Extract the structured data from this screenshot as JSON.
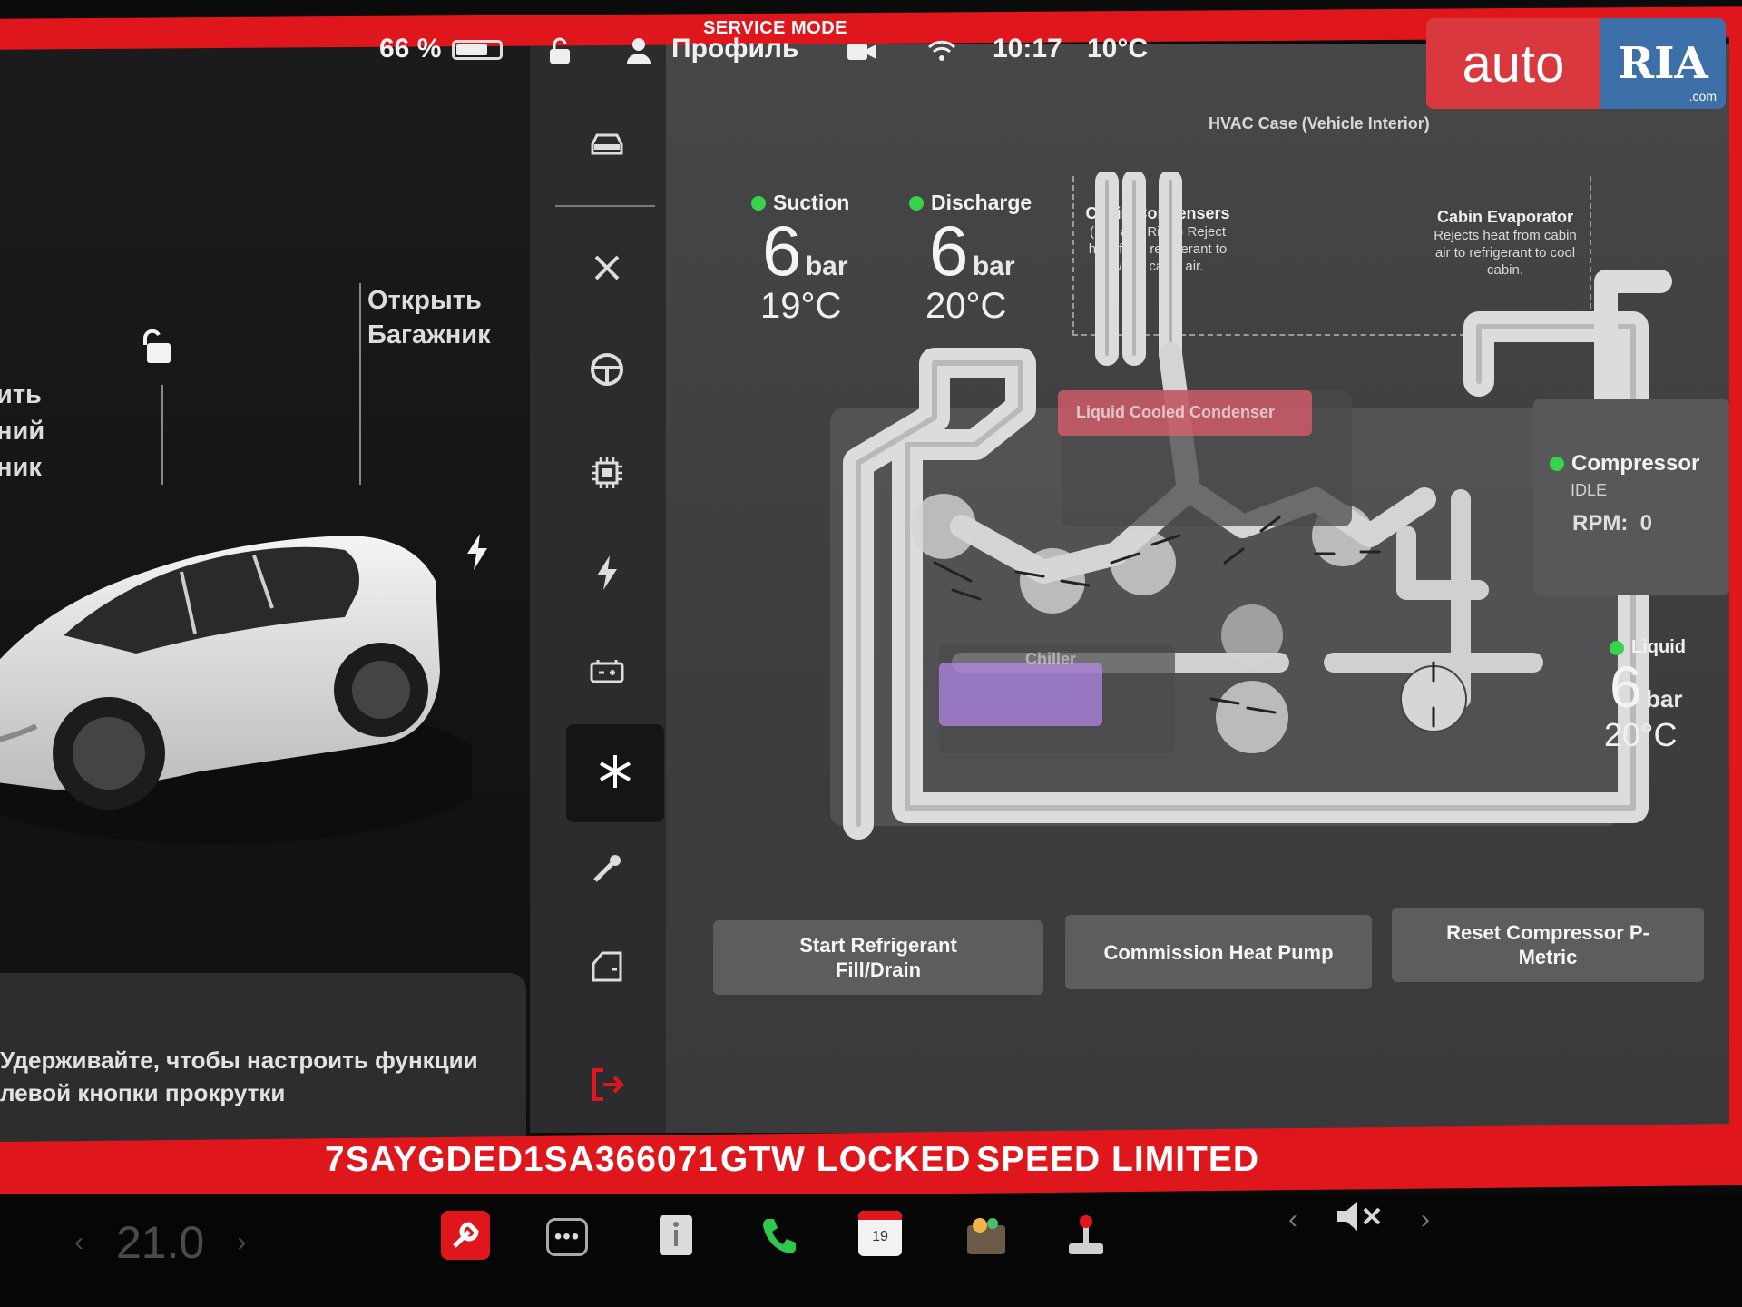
{
  "header": {
    "mode_banner": "SERVICE MODE",
    "battery_pct": "66 %",
    "profile": "Профиль",
    "time": "10:17",
    "outside_temp": "10°C"
  },
  "watermark": {
    "part1": "auto",
    "part2": "RIA",
    "part3": ".com"
  },
  "car": {
    "open_trunk": "Открыть Багажник",
    "open_frunk_partial": "ить\nний\nник",
    "scroll_hint": "Удерживайте, чтобы настроить функции левой кнопки прокрутки"
  },
  "nav": {
    "items": [
      "car-icon",
      "tools-icon",
      "steering-wheel-icon",
      "chip-icon",
      "lightning-icon",
      "battery-icon",
      "snowflake-icon",
      "pipette-icon",
      "door-icon",
      "exit-icon"
    ],
    "active": "snowflake-icon"
  },
  "hvac": {
    "case_label": "HVAC Case (Vehicle Interior)",
    "suction": {
      "label": "Suction",
      "pressure": "6",
      "unit": "bar",
      "temp": "19°C"
    },
    "discharge": {
      "label": "Discharge",
      "pressure": "6",
      "unit": "bar",
      "temp": "20°C"
    },
    "liquid": {
      "label": "Liquid",
      "pressure": "6",
      "unit": "bar",
      "temp": "20°C"
    },
    "cabin_condensers": {
      "title": "Cabin Condensers",
      "body": "(Left and Right) Reject heat from refrigerant to warm cabin air."
    },
    "cabin_evaporator": {
      "title": "Cabin Evaporator",
      "body": "Rejects heat from cabin air to refrigerant to cool cabin."
    },
    "liquid_condenser": "Liquid Cooled Condenser",
    "chiller": "Chiller",
    "compressor": {
      "title": "Compressor",
      "status": "IDLE",
      "rpm_label": "RPM:",
      "rpm_value": "0"
    }
  },
  "actions": {
    "fill_drain": "Start Refrigerant Fill/Drain",
    "commission": "Commission Heat Pump",
    "reset": "Reset Compressor P-Metric"
  },
  "footer": {
    "vin": "7SAYGDED1SA366071",
    "gtw": "GTW LOCKED",
    "speed": "SPEED LIMITED"
  },
  "taskbar": {
    "temp": "21.0",
    "calendar_day": "19",
    "icons": [
      "wrench-icon",
      "more-icon",
      "manual-icon",
      "phone-icon",
      "calendar-icon",
      "toybox-icon",
      "joystick-icon"
    ]
  },
  "colors": {
    "accent_red": "#e0161d",
    "status_green": "#35d44a"
  }
}
